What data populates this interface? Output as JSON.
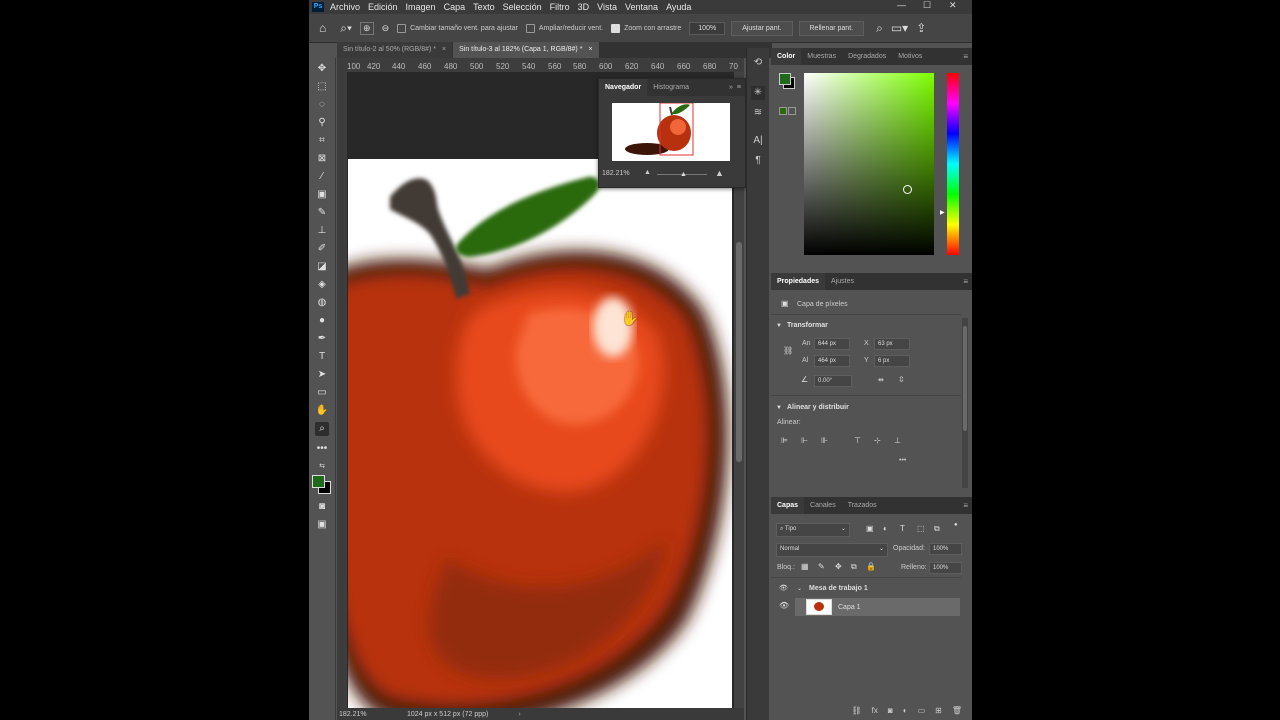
{
  "menubar": {
    "logo": "Ps",
    "items": [
      "Archivo",
      "Edición",
      "Imagen",
      "Capa",
      "Texto",
      "Selección",
      "Filtro",
      "3D",
      "Vista",
      "Ventana",
      "Ayuda"
    ],
    "minimize": "—",
    "maximize": "☐",
    "close": "✕"
  },
  "options": {
    "resize_windows": "Cambiar tamaño vent. para ajustar",
    "zoom_all": "Ampliar/reducir vent.",
    "scrubby_zoom": "Zoom con arrastre",
    "zoom_value": "100%",
    "fit_screen": "Ajustar pant.",
    "fill_screen": "Rellenar pant."
  },
  "tabs": [
    {
      "label": "Sin título-2 al 50% (RGB/8#) *",
      "close": "×"
    },
    {
      "label": "Sin título-3 al 182% (Capa 1, RGB/8#) *",
      "close": "×"
    }
  ],
  "ruler": {
    "h_ticks": [
      "100",
      "420",
      "440",
      "460",
      "480",
      "500",
      "520",
      "540",
      "560",
      "580",
      "600",
      "620",
      "640",
      "660",
      "680",
      "70"
    ]
  },
  "navigator": {
    "tabs": [
      "Navegador",
      "Histograma"
    ],
    "zoom": "182.21%"
  },
  "status": {
    "zoom": "182.21%",
    "doc_info": "1024 px x 512 px (72 ppp)"
  },
  "color_panel": {
    "tabs": [
      "Color",
      "Muestras",
      "Degradados",
      "Motivos"
    ],
    "fg_color": "#1f6a1a",
    "hue_color": "#7dff00"
  },
  "properties": {
    "tabs": [
      "Propiedades",
      "Ajustes"
    ],
    "layer_type": "Capa de píxeles",
    "transform_title": "Transformar",
    "w_label": "An",
    "w_value": "644 px",
    "x_label": "X",
    "x_value": "63 px",
    "h_label": "Al",
    "h_value": "464 px",
    "y_label": "Y",
    "y_value": "6 px",
    "angle_value": "0.00°",
    "align_title": "Alinear y distribuir",
    "align_label": "Alinear:",
    "more": "•••"
  },
  "layers": {
    "tabs": [
      "Capas",
      "Canales",
      "Trazados"
    ],
    "filter_label": "Tipo",
    "blend_mode": "Normal",
    "opacity_label": "Opacidad:",
    "opacity_value": "100%",
    "lock_label": "Bloq.:",
    "fill_label": "Relleno:",
    "fill_value": "100%",
    "group_name": "Mesa de trabajo 1",
    "layer_name": "Capa 1"
  }
}
